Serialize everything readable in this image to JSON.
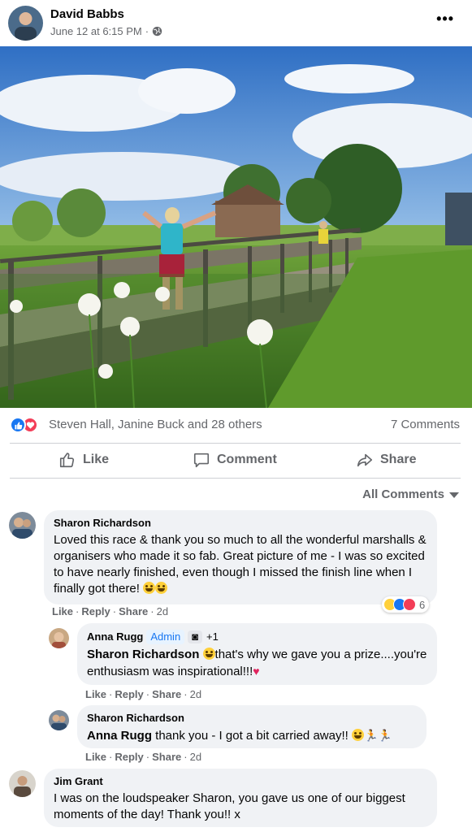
{
  "post": {
    "author": "David Babbs",
    "timestamp": "June 12 at 6:15 PM",
    "privacy_icon": "globe-icon",
    "more_icon": "more-options-icon",
    "more_label": "•••",
    "photo_alt": "Runner on a wooden bridge over a river with wildflowers"
  },
  "reactions": {
    "names": "Steven Hall, Janine Buck and 28 others",
    "comments": "7 Comments",
    "icons": [
      "like-icon",
      "love-icon"
    ]
  },
  "actions": {
    "like": "Like",
    "comment": "Comment",
    "share": "Share"
  },
  "comments_filter": "All Comments",
  "comments": [
    {
      "name": "Sharon Richardson",
      "text": "Loved this race & thank you so much to all the wonderful marshalls & organisers who made it so fab. Great picture of me - I was so excited to have nearly finished, even though I missed the finish line when I finally got there!",
      "like": "Like",
      "reply": "Reply",
      "share": "Share",
      "time": "2d",
      "reaction_count": "6"
    },
    {
      "name": "Anna Rugg",
      "badge": "Admin",
      "extra": "+1",
      "tag": "Sharon Richardson",
      "text": "that's why we gave you a prize....you're enthusiasm was inspirational!!!",
      "like": "Like",
      "reply": "Reply",
      "share": "Share",
      "time": "2d"
    },
    {
      "name": "Sharon Richardson",
      "tag": "Anna Rugg",
      "text": "thank you - I got a bit carried away!!",
      "like": "Like",
      "reply": "Reply",
      "share": "Share",
      "time": "2d"
    },
    {
      "name": "Jim Grant",
      "text": "I was on the loudspeaker Sharon, you gave us one of our biggest moments of the day! Thank you!! x"
    }
  ],
  "colors": {
    "brand": "#1877f2",
    "love": "#f33e58",
    "muted": "#65676b",
    "bubble": "#f0f2f5"
  }
}
